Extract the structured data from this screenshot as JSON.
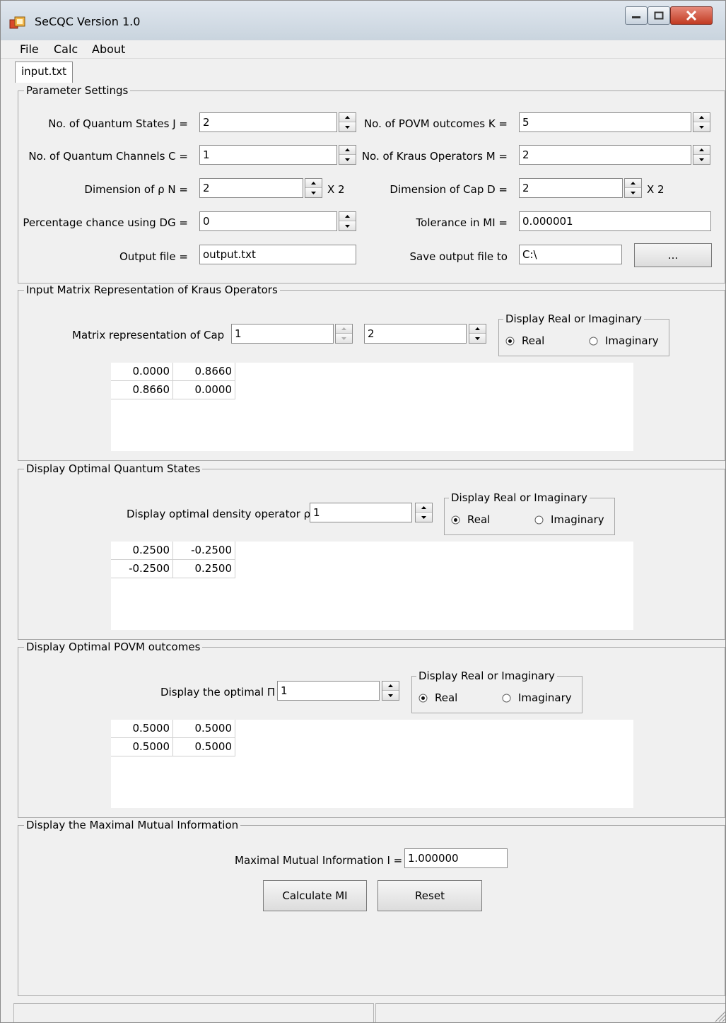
{
  "window": {
    "title": "SeCQC Version 1.0"
  },
  "menu": [
    "File",
    "Calc",
    "About"
  ],
  "tab": "input.txt",
  "params": {
    "title": "Parameter Settings",
    "states_label": "No. of Quantum States J =",
    "states_value": "2",
    "channels_label": "No. of Quantum Channels C =",
    "channels_value": "1",
    "dim_rho_label": "Dimension of ρ N =",
    "dim_rho_value": "2",
    "dim_rho_suffix": "X  2",
    "dg_label": "Percentage chance using DG =",
    "dg_value": "0",
    "output_label": "Output file =",
    "output_value": "output.txt",
    "povm_label": "No. of POVM outcomes K =",
    "povm_value": "5",
    "kraus_label": "No. of Kraus Operators M =",
    "kraus_value": "2",
    "dim_cap_label": "Dimension of Cap D =",
    "dim_cap_value": "2",
    "dim_cap_suffix": "X  2",
    "tol_label": "Tolerance in MI =",
    "tol_value": "0.000001",
    "save_label": "Save output file to",
    "save_value": "C:\\",
    "browse_label": "..."
  },
  "kraus": {
    "title": "Input Matrix Representation of Kraus Operators",
    "matrix_label": "Matrix representation of Cap",
    "idx1": "1",
    "idx2": "2",
    "radio_title": "Display Real or Imaginary",
    "real": "Real",
    "imag": "Imaginary",
    "matrix": [
      [
        "0.0000",
        "0.8660"
      ],
      [
        "0.8660",
        "0.0000"
      ]
    ]
  },
  "states": {
    "title": "Display Optimal Quantum States",
    "label": "Display optimal density operator ρ",
    "idx": "1",
    "radio_title": "Display Real or Imaginary",
    "real": "Real",
    "imag": "Imaginary",
    "matrix": [
      [
        "0.2500",
        "-0.2500"
      ],
      [
        "-0.2500",
        "0.2500"
      ]
    ]
  },
  "povm": {
    "title": "Display Optimal POVM outcomes",
    "label": "Display the optimal Π",
    "idx": "1",
    "radio_title": "Display Real or Imaginary",
    "real": "Real",
    "imag": "Imaginary",
    "matrix": [
      [
        "0.5000",
        "0.5000"
      ],
      [
        "0.5000",
        "0.5000"
      ]
    ]
  },
  "mi": {
    "title": "Display the Maximal Mutual Information",
    "label": "Maximal Mutual Information I =",
    "value": "1.000000",
    "calc_button": "Calculate MI",
    "reset_button": "Reset"
  }
}
